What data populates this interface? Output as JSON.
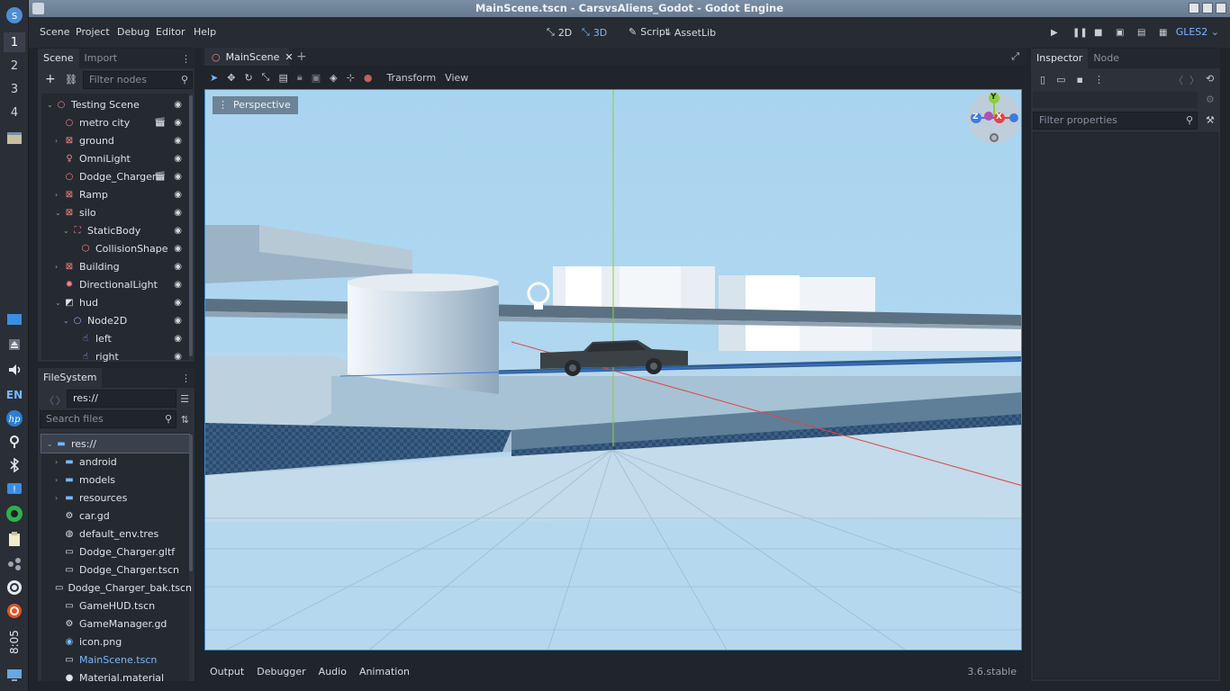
{
  "taskbar": {
    "workspaces": [
      "1",
      "2",
      "3",
      "4"
    ],
    "clock": "8:05",
    "lang": "EN"
  },
  "window": {
    "title": "MainScene.tscn - CarsvsAliens_Godot - Godot Engine"
  },
  "menubar": {
    "menus": [
      "Scene",
      "Project",
      "Debug",
      "Editor",
      "Help"
    ],
    "modes": [
      "2D",
      "3D",
      "Script",
      "AssetLib"
    ],
    "renderer": "GLES2"
  },
  "scene_dock": {
    "tabs": [
      "Scene",
      "Import"
    ],
    "filter_placeholder": "Filter nodes",
    "nodes": [
      {
        "label": "Testing Scene",
        "icon": "node3d-icon",
        "indent": 0,
        "arrow": "down",
        "film": false
      },
      {
        "label": "metro city",
        "icon": "node3d-icon",
        "indent": 1,
        "arrow": "",
        "film": true
      },
      {
        "label": "ground",
        "icon": "mesh-icon",
        "indent": 1,
        "arrow": "right",
        "film": false
      },
      {
        "label": "OmniLight",
        "icon": "light-icon",
        "indent": 1,
        "arrow": "",
        "film": false
      },
      {
        "label": "Dodge_Charger",
        "icon": "node3d-icon",
        "indent": 1,
        "arrow": "",
        "film": true
      },
      {
        "label": "Ramp",
        "icon": "mesh-icon",
        "indent": 1,
        "arrow": "right",
        "film": false
      },
      {
        "label": "silo",
        "icon": "mesh-icon",
        "indent": 1,
        "arrow": "down",
        "film": false
      },
      {
        "label": "StaticBody",
        "icon": "staticbody-icon",
        "indent": 2,
        "arrow": "down",
        "film": false
      },
      {
        "label": "CollisionShape",
        "icon": "collision-icon",
        "indent": 3,
        "arrow": "",
        "film": false
      },
      {
        "label": "Building",
        "icon": "mesh-icon",
        "indent": 1,
        "arrow": "right",
        "film": false
      },
      {
        "label": "DirectionalLight",
        "icon": "sun-icon",
        "indent": 1,
        "arrow": "",
        "film": false
      },
      {
        "label": "hud",
        "icon": "canvas-icon",
        "indent": 1,
        "arrow": "down",
        "film": false
      },
      {
        "label": "Node2D",
        "icon": "node2d-icon",
        "indent": 2,
        "arrow": "down",
        "film": false
      },
      {
        "label": "left",
        "icon": "touch-icon",
        "indent": 3,
        "arrow": "",
        "film": false
      },
      {
        "label": "right",
        "icon": "touch-icon",
        "indent": 3,
        "arrow": "",
        "film": false
      }
    ]
  },
  "filesystem": {
    "tab": "FileSystem",
    "path": "res://",
    "search_placeholder": "Search files",
    "items": [
      {
        "label": "res://",
        "icon": "folder-icon",
        "indent": 0,
        "arrow": "down",
        "selected": true
      },
      {
        "label": "android",
        "icon": "folder-icon",
        "indent": 1,
        "arrow": "right"
      },
      {
        "label": "models",
        "icon": "folder-icon",
        "indent": 1,
        "arrow": "right"
      },
      {
        "label": "resources",
        "icon": "folder-icon",
        "indent": 1,
        "arrow": "right"
      },
      {
        "label": "car.gd",
        "icon": "gear-icon",
        "indent": 1,
        "arrow": ""
      },
      {
        "label": "default_env.tres",
        "icon": "globe-icon",
        "indent": 1,
        "arrow": ""
      },
      {
        "label": "Dodge_Charger.gltf",
        "icon": "clapper-icon",
        "indent": 1,
        "arrow": ""
      },
      {
        "label": "Dodge_Charger.tscn",
        "icon": "clapper-icon",
        "indent": 1,
        "arrow": ""
      },
      {
        "label": "Dodge_Charger_bak.tscn",
        "icon": "clapper-icon",
        "indent": 1,
        "arrow": ""
      },
      {
        "label": "GameHUD.tscn",
        "icon": "clapper-icon",
        "indent": 1,
        "arrow": ""
      },
      {
        "label": "GameManager.gd",
        "icon": "gear-icon",
        "indent": 1,
        "arrow": ""
      },
      {
        "label": "icon.png",
        "icon": "image-icon",
        "indent": 1,
        "arrow": ""
      },
      {
        "label": "MainScene.tscn",
        "icon": "clapper-icon",
        "indent": 1,
        "arrow": "",
        "active": true
      },
      {
        "label": "Material.material",
        "icon": "sphere-icon",
        "indent": 1,
        "arrow": ""
      }
    ]
  },
  "editor": {
    "tab": "MainScene",
    "toolbar_menus": [
      "Transform",
      "View"
    ],
    "perspective_label": "Perspective",
    "gizmo": {
      "y": "Y",
      "x": "X",
      "z": "Z"
    },
    "bottom_tabs": [
      "Output",
      "Debugger",
      "Audio",
      "Animation"
    ],
    "version": "3.6.stable"
  },
  "inspector": {
    "tabs": [
      "Inspector",
      "Node"
    ],
    "filter_placeholder": "Filter properties"
  },
  "colors": {
    "accent": "#7ab7ff",
    "bg": "#20242b",
    "panel": "#2c313a",
    "sky": "#a8d3ee"
  }
}
